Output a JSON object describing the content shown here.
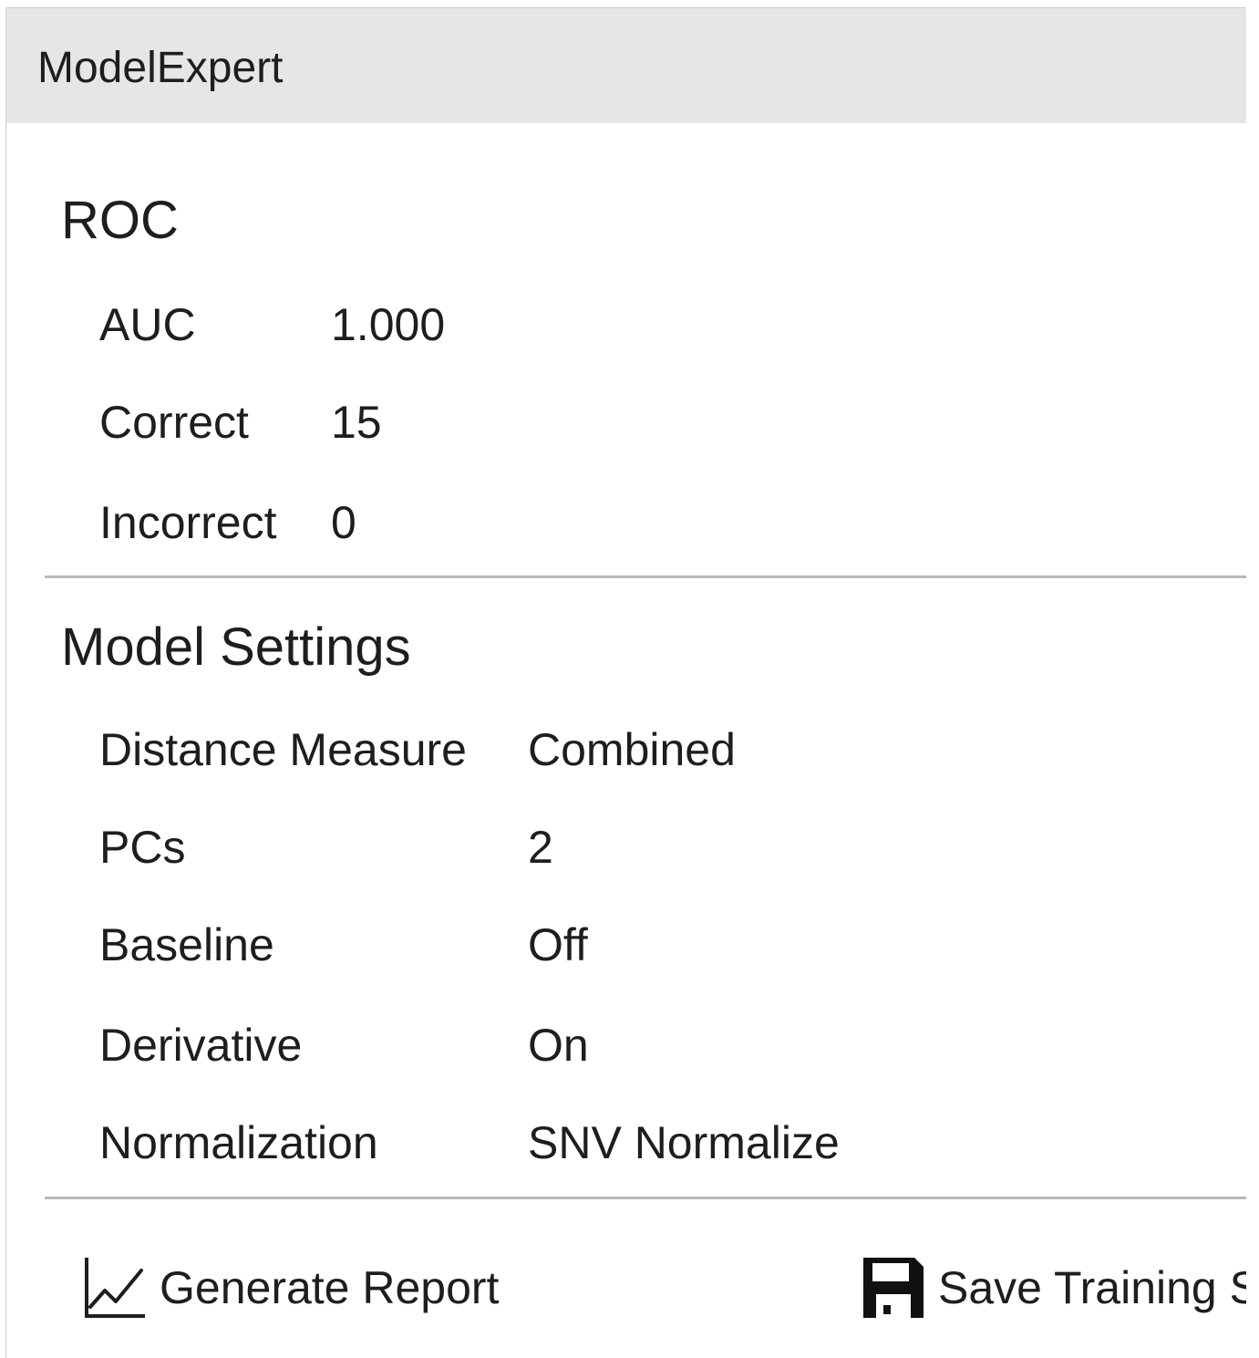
{
  "window": {
    "title": "ModelExpert"
  },
  "roc": {
    "heading": "ROC",
    "rows": [
      {
        "label": "AUC",
        "value": "1.000"
      },
      {
        "label": "Correct",
        "value": "15"
      },
      {
        "label": "Incorrect",
        "value": "0"
      }
    ]
  },
  "model_settings": {
    "heading": "Model Settings",
    "rows": [
      {
        "label": "Distance Measure",
        "value": "Combined"
      },
      {
        "label": "PCs",
        "value": "2"
      },
      {
        "label": "Baseline",
        "value": "Off"
      },
      {
        "label": "Derivative",
        "value": "On"
      },
      {
        "label": "Normalization",
        "value": "SNV Normalize"
      }
    ]
  },
  "actions": {
    "generate_report": {
      "label": "Generate Report",
      "icon": "line-chart-icon"
    },
    "save_training": {
      "label": "Save Training S",
      "icon": "save-icon"
    }
  }
}
